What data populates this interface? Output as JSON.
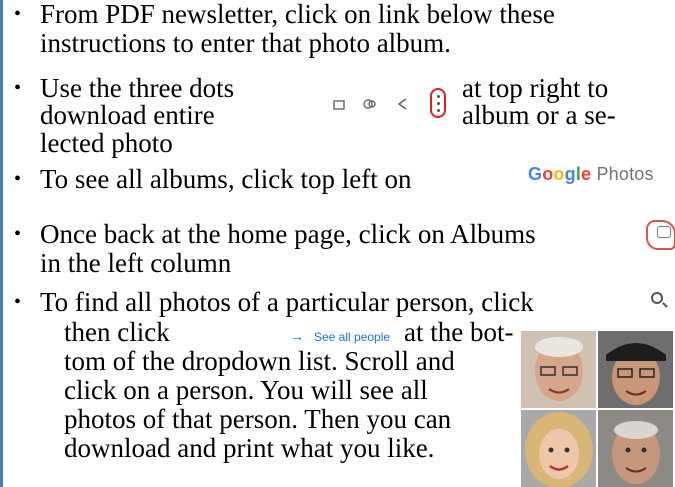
{
  "bullets": [
    {
      "lines": [
        "From PDF newsletter, click on link below these",
        "instructions to enter that photo album."
      ]
    },
    {
      "line1_left": "Use the three dots",
      "line1_right": "at top right to",
      "line2_left": "download entire",
      "line2_right": "album or a se-",
      "line3": "lected photo"
    },
    {
      "text": "To see all albums, click top left on"
    },
    {
      "line1": "Once back at the home page, click on Albums",
      "line2": "in the left column"
    },
    {
      "line1": "To find all photos of a particular person, click",
      "line2_left": "then click",
      "line2_right": "at the bot-",
      "line3": "tom of the dropdown list. Scroll and",
      "line4": "click on a person. You will see all",
      "line5": "photos of that person. Then you can",
      "line6": "download and print what you like."
    }
  ],
  "google_photos_logo": {
    "google": "Google",
    "photos": "Photos"
  },
  "see_all_people": "See all people",
  "icons": {
    "bookmark": "bookmark-icon",
    "link": "link-icon",
    "share": "share-icon",
    "more": "more-vert-icon",
    "albums": "albums-icon",
    "search": "search-icon",
    "arrow": "arrow-right-icon"
  },
  "colors": {
    "frame": "#4a7cc0",
    "highlight": "#e02020",
    "link": "#1a73e8"
  }
}
